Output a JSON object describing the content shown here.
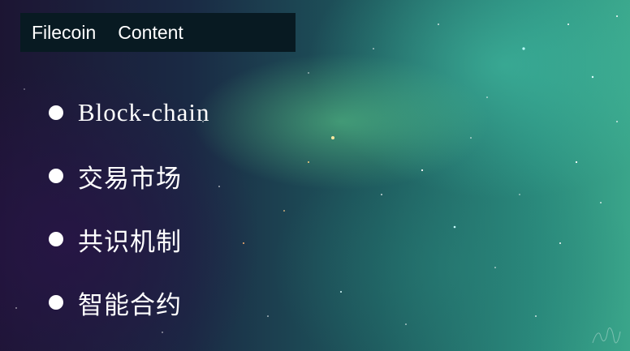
{
  "title_bar": {
    "words": [
      "Filecoin",
      "Content"
    ]
  },
  "bullets": [
    {
      "label": "Block-chain"
    },
    {
      "label": "交易市场"
    },
    {
      "label": "共识机制"
    },
    {
      "label": "智能合约"
    }
  ],
  "colors": {
    "title_bar_bg": "#081a22",
    "text": "#ffffff"
  }
}
